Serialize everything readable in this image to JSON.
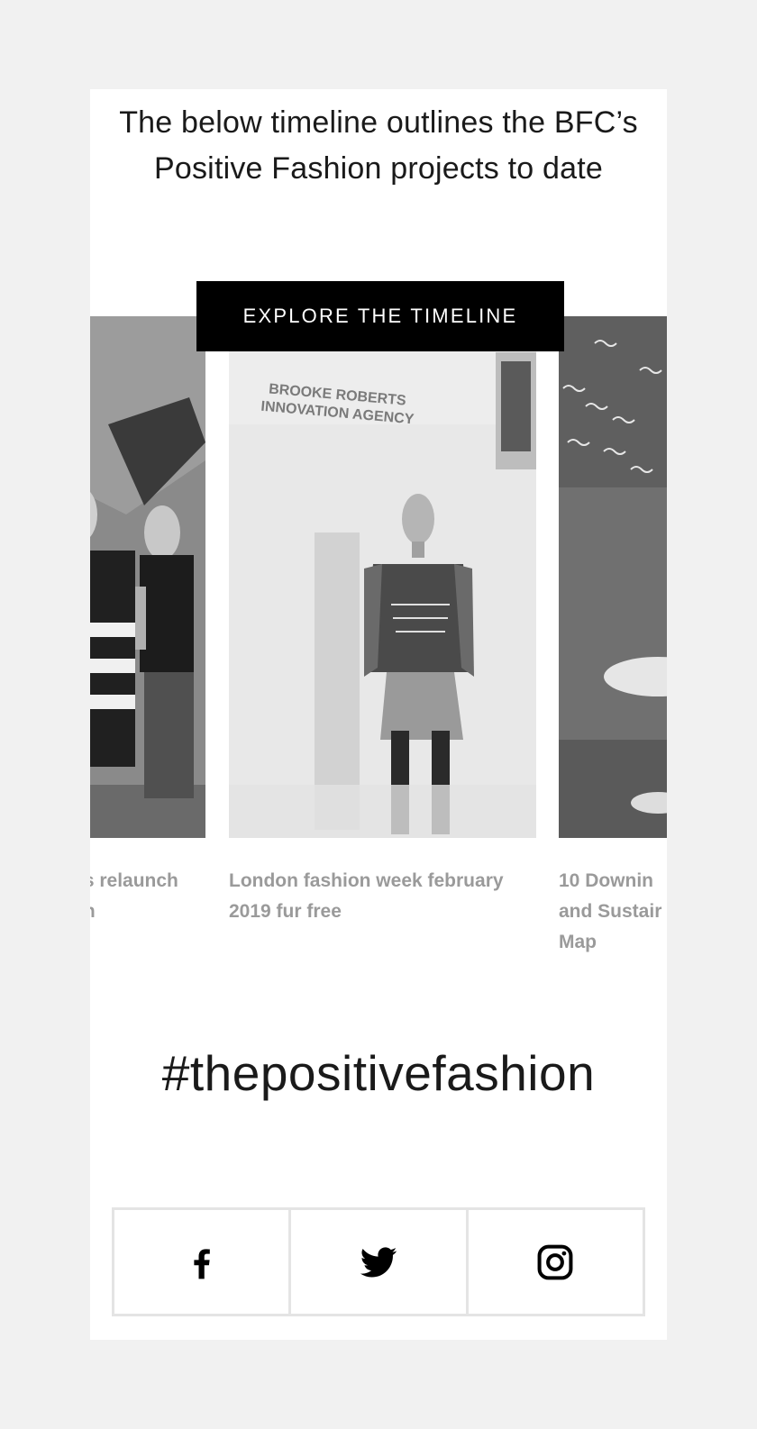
{
  "intro": {
    "text": "The below timeline outlines the BFC’s Positive Fashion projects to date"
  },
  "cta": {
    "label": "EXPLORE THE TIMELINE"
  },
  "carousel": {
    "slides": [
      {
        "caption_lines": [
          "ns relaunch",
          "on"
        ]
      },
      {
        "image_text": [
          "BROOKE ROBERTS",
          "INNOVATION AGENCY"
        ],
        "caption": "London fashion week february 2019 fur free"
      },
      {
        "caption_lines": [
          "10 Downin",
          "and Sustair",
          "Map"
        ]
      }
    ]
  },
  "hashtag": "#thepositivefashion",
  "social": {
    "facebook_icon": "facebook-icon",
    "twitter_icon": "twitter-icon",
    "instagram_icon": "instagram-icon"
  },
  "colors": {
    "background": "#f1f1f1",
    "card": "#ffffff",
    "button": "#000000",
    "caption": "#9a9a9a"
  }
}
